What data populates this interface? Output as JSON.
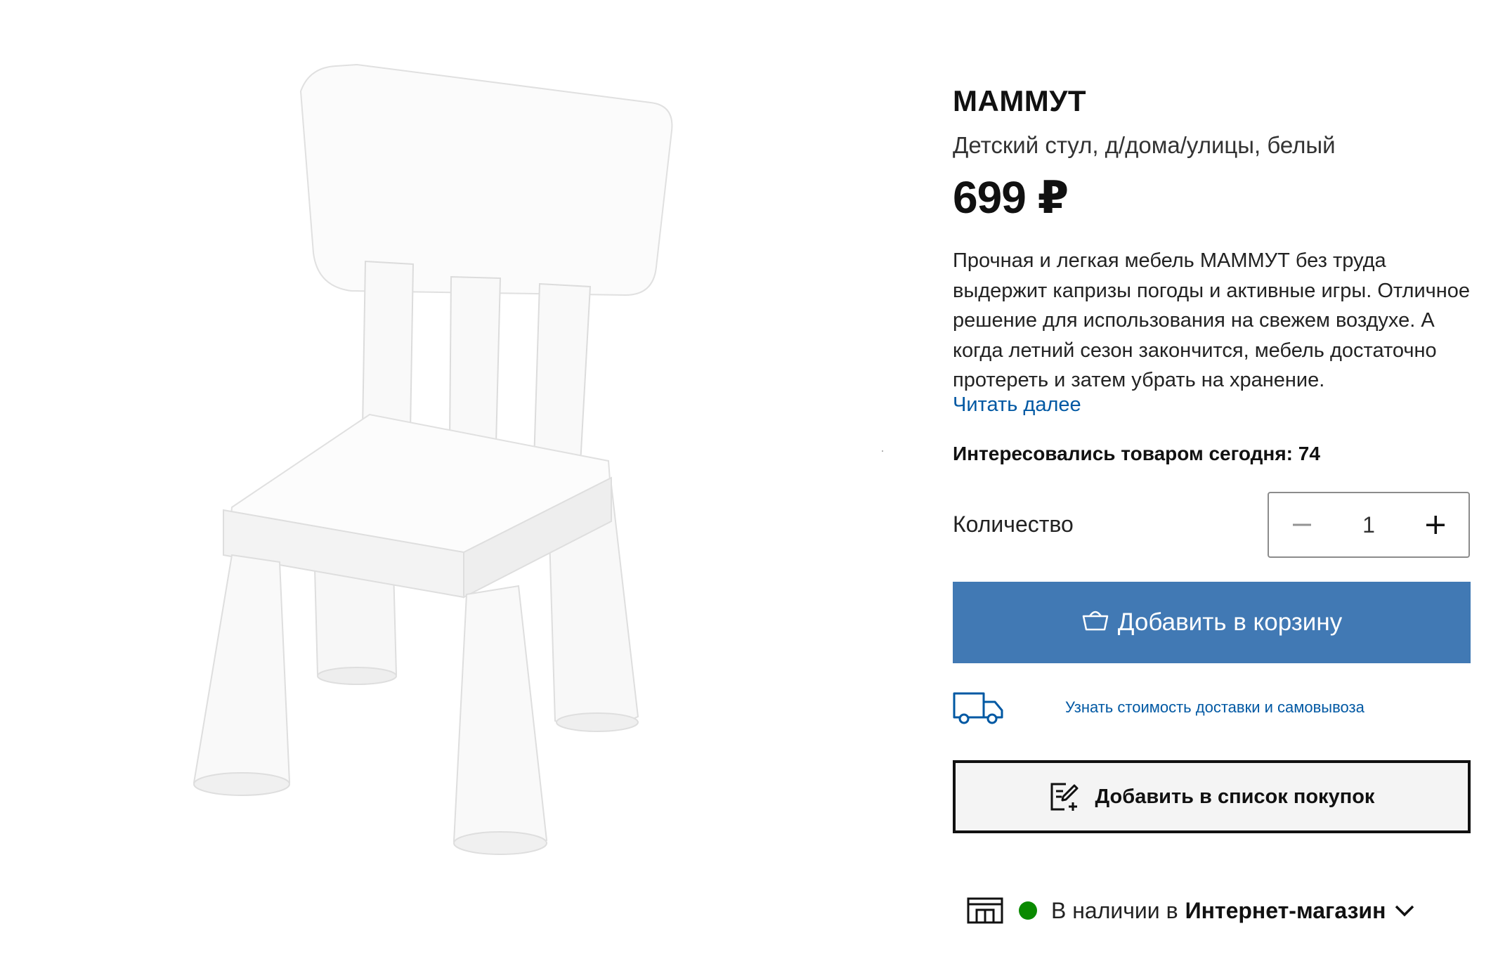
{
  "product": {
    "name": "МАММУТ",
    "subtitle": "Детский стул, д/дома/улицы, белый",
    "price": "699 ₽",
    "description": "Прочная и легкая мебель МАММУТ без труда выдержит капризы погоды и активные игры. Отличное решение для использования на свежем воздухе. А когда летний сезон закончится, мебель достаточно протереть и затем убрать на хранение.",
    "read_more": "Читать далее",
    "interest_label": "Интересовались товаром сегодня:",
    "interest_count": "74",
    "image_icon": "white-kids-chair-image"
  },
  "quantity": {
    "label": "Количество",
    "value": "1",
    "minus_icon": "minus-icon",
    "plus_icon": "plus-icon"
  },
  "actions": {
    "add_to_cart": "Добавить в корзину",
    "cart_icon": "shopping-basket-icon",
    "delivery_link": "Узнать стоимость доставки и самовывоза",
    "delivery_icon": "truck-icon",
    "add_to_list": "Добавить в список покупок",
    "list_icon": "edit-list-icon"
  },
  "availability": {
    "prefix": "В наличии в",
    "store": "Интернет-магазин",
    "status_color": "#0a8a00",
    "store_icon": "store-icon",
    "chevron_icon": "chevron-down-icon"
  },
  "colors": {
    "primary_button": "#4179b4",
    "link": "#0058a3",
    "in_stock": "#0a8a00"
  }
}
